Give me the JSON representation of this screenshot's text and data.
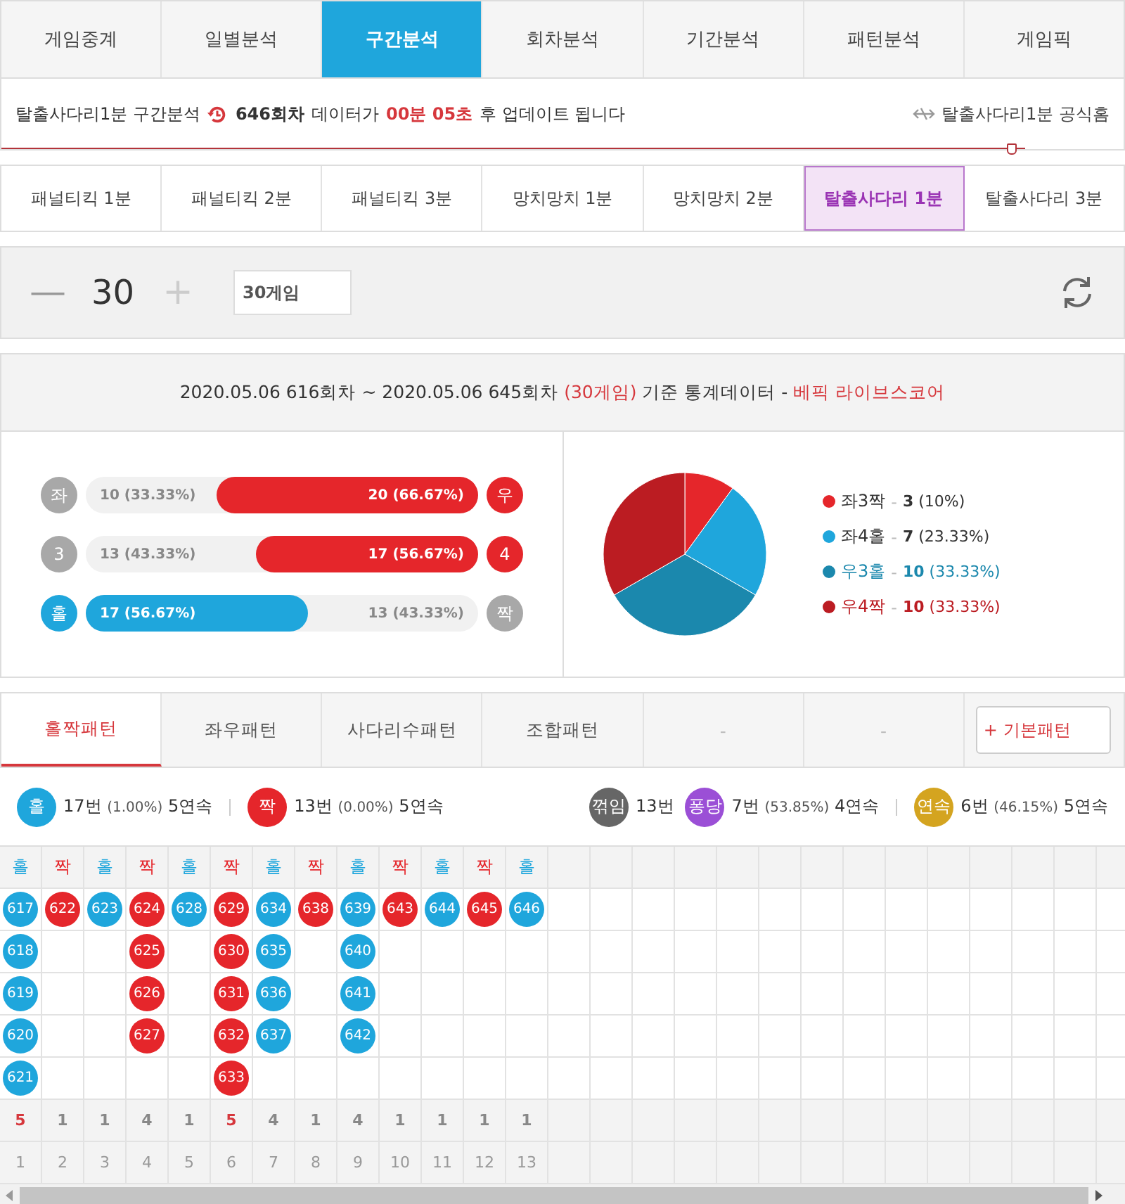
{
  "main_tabs": [
    {
      "label": "게임중계",
      "selected": false
    },
    {
      "label": "일별분석",
      "selected": false
    },
    {
      "label": "구간분석",
      "selected": true
    },
    {
      "label": "회차분석",
      "selected": false
    },
    {
      "label": "기간분석",
      "selected": false
    },
    {
      "label": "패턴분석",
      "selected": false
    },
    {
      "label": "게임픽",
      "selected": false
    }
  ],
  "info_bar": {
    "title": "탈출사다리1분 구간분석",
    "round": "646회차",
    "text_before": "데이터가",
    "countdown": "00분 05초",
    "text_after": "후 업데이트 됩니다",
    "home_link": "탈출사다리1분 공식홈"
  },
  "game_tabs": [
    {
      "label": "패널티킥 1분",
      "selected": false
    },
    {
      "label": "패널티킥 2분",
      "selected": false
    },
    {
      "label": "패널티킥 3분",
      "selected": false
    },
    {
      "label": "망치망치 1분",
      "selected": false
    },
    {
      "label": "망치망치 2분",
      "selected": false
    },
    {
      "label": "탈출사다리 1분",
      "selected": true
    },
    {
      "label": "탈출사다리 3분",
      "selected": false
    }
  ],
  "count_control": {
    "minus": "—",
    "value": "30",
    "plus": "+",
    "field_value": "30게임"
  },
  "stats_header": {
    "range": "2020.05.06 616회차 ~ 2020.05.06 645회차",
    "games": "(30게임)",
    "basis": "기준 통계데이터 -",
    "source": "베픽 라이브스코어"
  },
  "bars": [
    {
      "kind": "right",
      "left": {
        "text": "좌",
        "kind": "grey"
      },
      "right": {
        "text": "우",
        "kind": "red"
      },
      "left_text": "10 (33.33%)",
      "right_text": "20 (66.67%)",
      "level": 0.6667
    },
    {
      "kind": "right",
      "left": {
        "text": "3",
        "kind": "grey"
      },
      "right": {
        "text": "4",
        "kind": "red"
      },
      "left_text": "13 (43.33%)",
      "right_text": "17 (56.67%)",
      "level": 0.5667
    },
    {
      "kind": "left",
      "left": {
        "text": "홀",
        "kind": "blue"
      },
      "right": {
        "text": "짝",
        "kind": "grey"
      },
      "left_text": "17 (56.67%)",
      "right_text": "13 (43.33%)",
      "level": 0.5667
    }
  ],
  "pie": {
    "chart_data": {
      "type": "pie",
      "categories": [
        "좌3짝",
        "좌4홀",
        "우3홀",
        "우4짝"
      ],
      "values": [
        3,
        7,
        10,
        10
      ]
    },
    "legend": [
      {
        "color": "#e5262b",
        "separator": "-",
        "count": "3",
        "pct": "(10%)",
        "kind": "plain"
      },
      {
        "color": "#1fa6dc",
        "separator": "-",
        "count": "7",
        "pct": "(23.33%)",
        "kind": "plain"
      },
      {
        "color": "#1b88ad",
        "separator": "-",
        "count": "10",
        "pct": "(33.33%)",
        "kind": "tinted"
      },
      {
        "color": "#bb1c22",
        "separator": "-",
        "count": "10",
        "pct": "(33.33%)",
        "kind": "tinted"
      }
    ]
  },
  "pattern_tabs": [
    {
      "label": "홀짝패턴",
      "selected": true
    },
    {
      "label": "좌우패턴",
      "selected": false
    },
    {
      "label": "사다리수패턴",
      "selected": false
    },
    {
      "label": "조합패턴",
      "selected": false
    },
    {
      "label": "-",
      "selected": false
    },
    {
      "label": "-",
      "selected": false
    }
  ],
  "basic_pattern_button": "+ 기본패턴",
  "summary": [
    {
      "badge": "홀",
      "color": "#1fa6dc",
      "count": "17번",
      "pct": "(1.00%)",
      "streak": "5연속"
    },
    {
      "badge": "짝",
      "color": "#e5262b",
      "count": "13번",
      "pct": "(0.00%)",
      "streak": "5연속"
    },
    {
      "badge": "꺾임",
      "color": "#666666",
      "count": "13번"
    },
    {
      "badge": "퐁당",
      "color": "#9b4fd6",
      "count": "7번",
      "pct": "(53.85%)",
      "streak": "4연속"
    },
    {
      "badge": "연속",
      "color": "#d4a420",
      "count": "6번",
      "pct": "(46.15%)",
      "streak": "5연속"
    }
  ],
  "pattern_columns": [
    {
      "label": "홀",
      "kind": "odd",
      "balls": [
        "617",
        "618",
        "619",
        "620",
        "621"
      ],
      "count": "5",
      "highlight": true,
      "index": "1"
    },
    {
      "label": "짝",
      "kind": "even",
      "balls": [
        "622"
      ],
      "count": "1",
      "highlight": false,
      "index": "2"
    },
    {
      "label": "홀",
      "kind": "odd",
      "balls": [
        "623"
      ],
      "count": "1",
      "highlight": false,
      "index": "3"
    },
    {
      "label": "짝",
      "kind": "even",
      "balls": [
        "624",
        "625",
        "626",
        "627"
      ],
      "count": "4",
      "highlight": false,
      "index": "4"
    },
    {
      "label": "홀",
      "kind": "odd",
      "balls": [
        "628"
      ],
      "count": "1",
      "highlight": false,
      "index": "5"
    },
    {
      "label": "짝",
      "kind": "even",
      "balls": [
        "629",
        "630",
        "631",
        "632",
        "633"
      ],
      "count": "5",
      "highlight": true,
      "index": "6"
    },
    {
      "label": "홀",
      "kind": "odd",
      "balls": [
        "634",
        "635",
        "636",
        "637"
      ],
      "count": "4",
      "highlight": false,
      "index": "7"
    },
    {
      "label": "짝",
      "kind": "even",
      "balls": [
        "638"
      ],
      "count": "1",
      "highlight": false,
      "index": "8"
    },
    {
      "label": "홀",
      "kind": "odd",
      "balls": [
        "639",
        "640",
        "641",
        "642"
      ],
      "count": "4",
      "highlight": false,
      "index": "9"
    },
    {
      "label": "짝",
      "kind": "even",
      "balls": [
        "643"
      ],
      "count": "1",
      "highlight": false,
      "index": "10"
    },
    {
      "label": "홀",
      "kind": "odd",
      "balls": [
        "644"
      ],
      "count": "1",
      "highlight": false,
      "index": "11"
    },
    {
      "label": "짝",
      "kind": "even",
      "balls": [
        "645"
      ],
      "count": "1",
      "highlight": false,
      "index": "12"
    },
    {
      "label": "홀",
      "kind": "odd",
      "balls": [
        "646"
      ],
      "count": "1",
      "highlight": false,
      "index": "13"
    }
  ]
}
